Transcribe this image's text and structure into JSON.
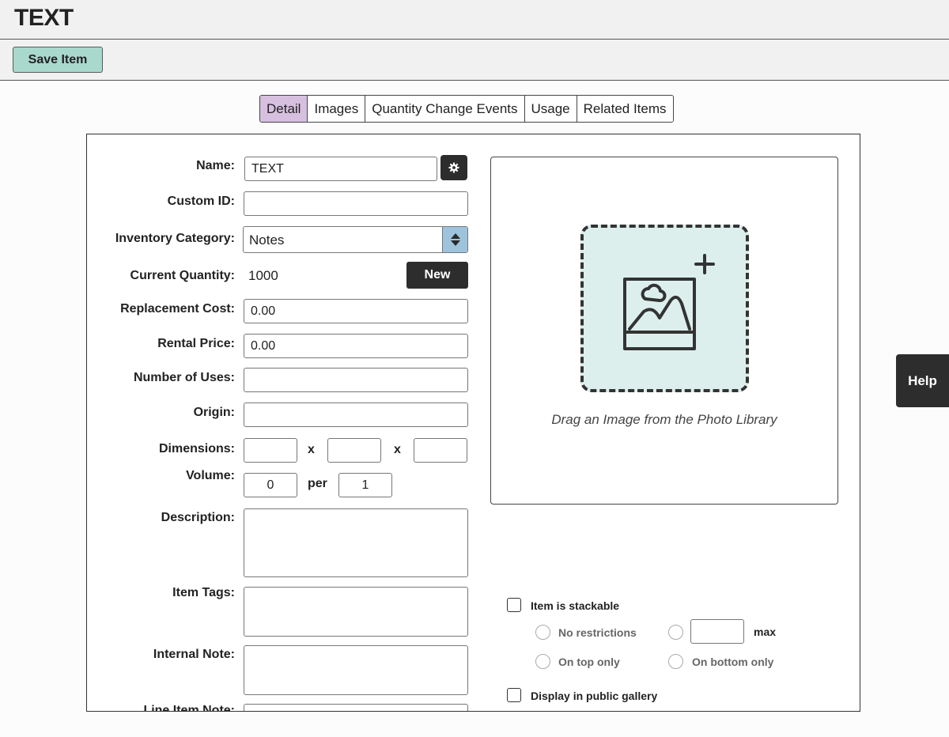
{
  "header": {
    "title": "TEXT"
  },
  "toolbar": {
    "save_label": "Save Item"
  },
  "tabs": [
    {
      "label": "Detail",
      "active": true
    },
    {
      "label": "Images"
    },
    {
      "label": "Quantity Change Events"
    },
    {
      "label": "Usage"
    },
    {
      "label": "Related Items"
    }
  ],
  "form": {
    "name_label": "Name:",
    "name_value": "TEXT",
    "custom_id_label": "Custom ID:",
    "custom_id_value": "",
    "category_label": "Inventory Category:",
    "category_value": "Notes",
    "quantity_label": "Current Quantity:",
    "quantity_value": "1000",
    "new_button": "New",
    "replacement_cost_label": "Replacement Cost:",
    "replacement_cost_value": "0.00",
    "rental_price_label": "Rental Price:",
    "rental_price_value": "0.00",
    "uses_label": "Number of Uses:",
    "origin_label": "Origin:",
    "dimensions_label": "Dimensions:",
    "dim_separator": "x",
    "volume_label": "Volume:",
    "volume_value": "0",
    "volume_per": "per",
    "volume_per_value": "1",
    "description_label": "Description:",
    "tags_label": "Item Tags:",
    "internal_note_label": "Internal Note:",
    "line_item_note_label": "Line Item Note:"
  },
  "image": {
    "drop_text": "Drag an Image from the Photo Library"
  },
  "options": {
    "stackable_label": "Item is stackable",
    "no_restrictions": "No restrictions",
    "max_label": "max",
    "top_only": "On top only",
    "bottom_only": "On bottom only",
    "public_gallery_label": "Display in public gallery"
  },
  "help_label": "Help",
  "colors": {
    "save_button": "#a9d8cd",
    "active_tab": "#d7bfe0",
    "dropzone": "#dcefec",
    "dark_button": "#2d2d2d"
  },
  "icons": [
    "gear-icon",
    "select-arrows-icon",
    "add-image-icon",
    "checkbox-icon",
    "radio-icon"
  ]
}
